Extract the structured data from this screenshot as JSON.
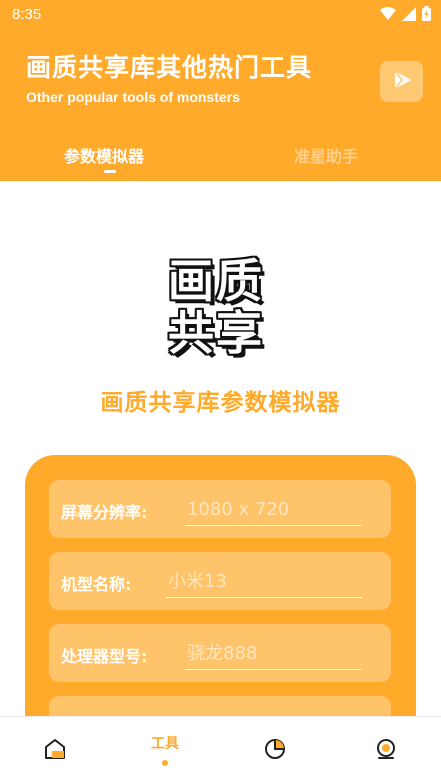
{
  "status_bar": {
    "time": "8:35"
  },
  "header": {
    "title": "画质共享库其他热门工具",
    "subtitle": "Other popular tools of monsters",
    "tabs": [
      {
        "label": "参数模拟器",
        "active": true
      },
      {
        "label": "准星助手",
        "active": false
      }
    ]
  },
  "main": {
    "logo_text": [
      "画",
      "质",
      "共",
      "享"
    ],
    "title": "画质共享库参数模拟器",
    "fields": [
      {
        "label": "屏幕分辨率:",
        "placeholder": "1080 x 720"
      },
      {
        "label": "机型名称:",
        "placeholder": "小米13"
      },
      {
        "label": "处理器型号:",
        "placeholder": "骁龙888"
      },
      {
        "label": "",
        "placeholder": ""
      }
    ]
  },
  "bottom_nav": {
    "items": [
      {
        "icon": "home-icon",
        "label": ""
      },
      {
        "icon": "tools-icon",
        "label": "工具",
        "active": true
      },
      {
        "icon": "pie-chart-icon",
        "label": ""
      },
      {
        "icon": "profile-icon",
        "label": ""
      }
    ]
  },
  "colors": {
    "accent": "#ffaa2b",
    "field_bg": "#ffc46a",
    "white": "#ffffff"
  }
}
